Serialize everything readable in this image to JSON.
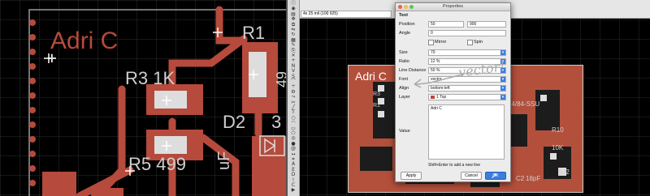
{
  "left_view": {
    "labels": {
      "title": "Adri C",
      "r1": "R1",
      "r3": "R3 1K",
      "d2": "D2",
      "d2_suffix": "3",
      "r5": "R5 499",
      "uf": "uF",
      "r1_val": "49"
    }
  },
  "toolbar": {
    "icons": [
      "info-icon",
      "eye-icon",
      "layers-icon",
      "move-icon",
      "copy-icon",
      "mirror-icon",
      "rotate-icon",
      "group-icon",
      "change-icon",
      "paste-icon",
      "delete-icon",
      "add-icon",
      "name-icon",
      "value-icon",
      "smash-icon",
      "miter-icon",
      "split-icon",
      "optimize-icon",
      "route-icon",
      "ripup-icon",
      "wire-icon",
      "text-icon",
      "circle-icon",
      "arc-icon",
      "rect-icon",
      "polygon-icon",
      "via-icon",
      "hole-icon",
      "attribute-icon",
      "dimension-icon",
      "ratsnest-icon",
      "auto-icon",
      "erc-icon",
      "drc-icon",
      "errors-icon",
      "cam-icon",
      "go-icon"
    ]
  },
  "topbar": {
    "grid_label": "4x 25 mil (100 925)"
  },
  "dialog": {
    "title": "Properties",
    "section": "Text",
    "position_label": "Position",
    "position_x": "50",
    "position_y": "900",
    "angle_label": "Angle",
    "angle_value": "0",
    "mirror_label": "Mirror",
    "spin_label": "Spin",
    "size_label": "Size",
    "size_value": "70",
    "ratio_label": "Ratio",
    "ratio_value": "12 %",
    "linedist_label": "Line Distance",
    "linedist_value": "50 %",
    "font_label": "Font",
    "font_value": "vector",
    "align_label": "Align",
    "align_value": "bottom-left",
    "layer_label": "Layer",
    "layer_value": "1 Top",
    "value_label": "Value",
    "value_text": "Adri C",
    "hint": "Shift+Enter to add a new line",
    "apply": "Apply",
    "cancel": "Cancel",
    "ok": "OK",
    "annotation": "vector!"
  },
  "right_view": {
    "labels": {
      "title": "Adri C",
      "r3": "R3",
      "r1": "R1",
      "chip": "44/84-SSU",
      "r10": "R10",
      "r10_val": "10K",
      "c": "C2",
      "cap": "18pF",
      "sj": "SJ2"
    }
  }
}
